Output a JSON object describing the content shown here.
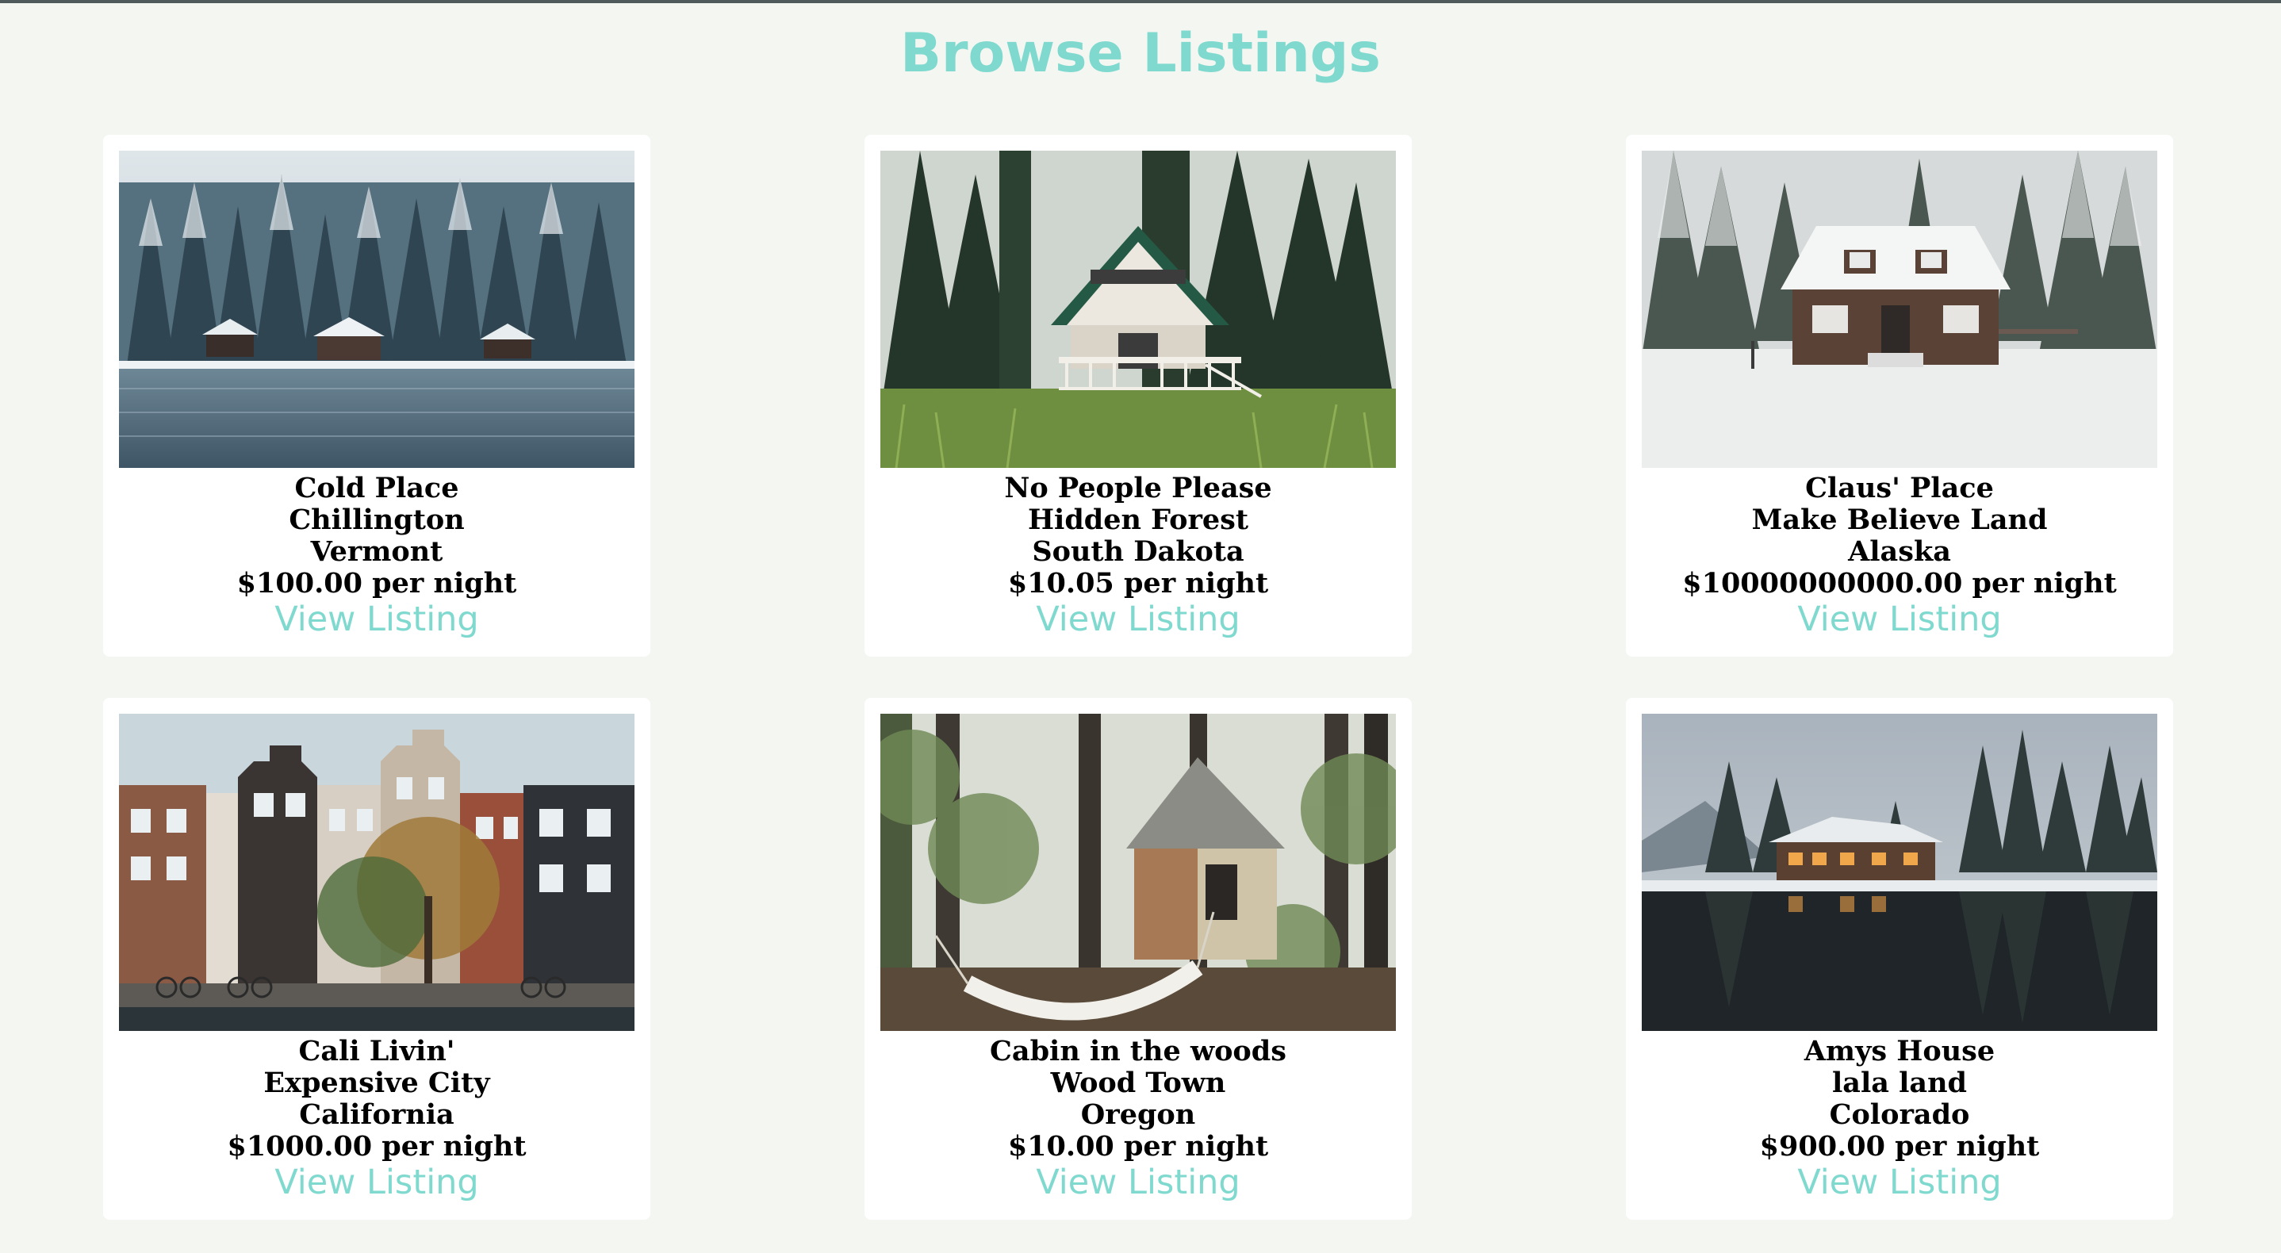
{
  "page": {
    "title": "Browse Listings"
  },
  "colors": {
    "accent": "#7fd9cf",
    "background": "#f4f7f1",
    "card": "#ffffff"
  },
  "listings": [
    {
      "name": "Cold Place",
      "city": "Chillington",
      "state": "Vermont",
      "price": "$100.00 per night",
      "link_label": "View Listing",
      "photo_icon": "snowy-lake-cabins-photo"
    },
    {
      "name": "No People Please",
      "city": "Hidden Forest",
      "state": "South Dakota",
      "price": "$10.05 per night",
      "link_label": "View Listing",
      "photo_icon": "forest-a-frame-cabin-photo"
    },
    {
      "name": "Claus' Place",
      "city": "Make Believe Land",
      "state": "Alaska",
      "price": "$10000000000.00 per night",
      "link_label": "View Listing",
      "photo_icon": "snowy-house-photo"
    },
    {
      "name": "Cali Livin'",
      "city": "Expensive City",
      "state": "California",
      "price": "$1000.00 per night",
      "link_label": "View Listing",
      "photo_icon": "canal-townhouses-photo"
    },
    {
      "name": "Cabin in the woods",
      "city": "Wood Town",
      "state": "Oregon",
      "price": "$10.00 per night",
      "link_label": "View Listing",
      "photo_icon": "woods-cabin-hammock-photo"
    },
    {
      "name": "Amys House",
      "city": "lala land",
      "state": "Colorado",
      "price": "$900.00 per night",
      "link_label": "View Listing",
      "photo_icon": "lake-lodge-photo"
    }
  ]
}
